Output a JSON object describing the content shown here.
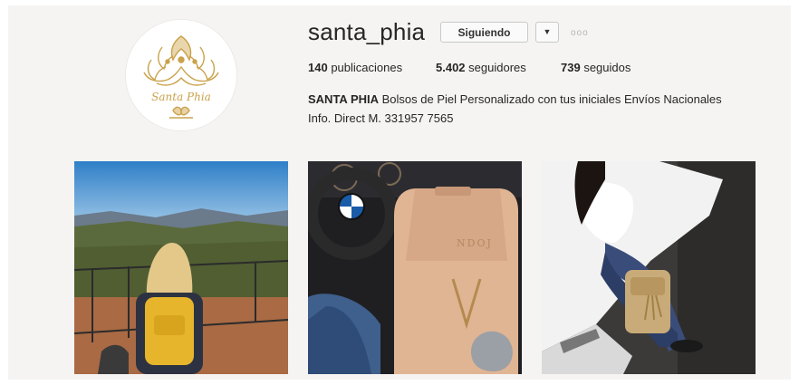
{
  "profile": {
    "username": "santa_phia",
    "follow_label": "Siguiendo",
    "dropdown_icon": "caret-down-icon",
    "more_icon": "more-options-icon",
    "more_glyph": "ooo",
    "avatar_script": "Santa Phia",
    "stats": {
      "posts_count": "140",
      "posts_label": "publicaciones",
      "followers_count": "5.402",
      "followers_label": "seguidores",
      "following_count": "739",
      "following_label": "seguidos"
    },
    "bio": {
      "name": "SANTA PHIA",
      "line1": "Bolsos de Piel Personalizado con tus iniciales Envíos Nacionales",
      "line2": "Info. Direct M. 331957 7565"
    }
  },
  "posts": [
    {
      "name": "post-mountain-view-yellow-backpack"
    },
    {
      "name": "post-car-interior-tan-backpack",
      "monogram": "NDOJ"
    },
    {
      "name": "post-car-hood-gold-backpack"
    }
  ],
  "colors": {
    "accent_gold": "#c9a24b",
    "page_bg": "#f5f4f2"
  }
}
